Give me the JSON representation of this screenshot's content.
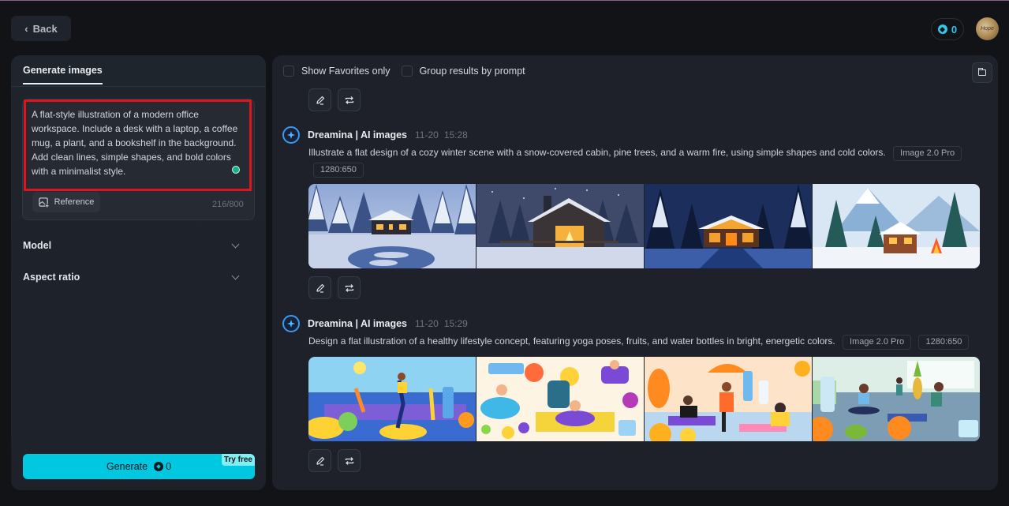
{
  "header": {
    "back_label": "Back",
    "credits": "0",
    "avatar_text": "Hope"
  },
  "left_panel": {
    "tab_label": "Generate images",
    "prompt_value": "A flat-style illustration of a modern office workspace. Include a desk with a laptop, a coffee mug, a plant, and a bookshelf in the background. Add clean lines, simple shapes, and bold colors with a minimalist style.",
    "reference_label": "Reference",
    "char_count": "216/800",
    "model_label": "Model",
    "aspect_ratio_label": "Aspect ratio",
    "generate_label": "Generate",
    "generate_cost": "0",
    "try_free_label": "Try free"
  },
  "right_panel": {
    "show_favorites_label": "Show Favorites only",
    "group_by_prompt_label": "Group results by prompt",
    "generations": [
      {
        "app_name": "Dreamina | AI images",
        "date": "11-20",
        "time": "15:28",
        "prompt": "Illustrate a flat design of a cozy winter scene with a snow-covered cabin, pine trees, and a warm fire, using simple shapes and cold colors.",
        "model_tag": "Image 2.0 Pro",
        "ratio_tag": "1280:650",
        "images": [
          "winter-cabin-twilight",
          "log-cabin-snowfall",
          "night-cabin-path",
          "mountain-cabin-campfire"
        ]
      },
      {
        "app_name": "Dreamina | AI images",
        "date": "11-20",
        "time": "15:29",
        "prompt": "Design a flat illustration of a healthy lifestyle concept, featuring yoga poses, fruits, and water bottles in bright, energetic colors.",
        "model_tag": "Image 2.0 Pro",
        "ratio_tag": "1280:650",
        "images": [
          "yoga-beach-fruits",
          "healthy-yoga-pattern",
          "yoga-group-pastel",
          "yoga-kitchen-oranges"
        ]
      }
    ]
  },
  "colors": {
    "accent_cyan": "#00c8e0",
    "credits_blue": "#31c8ea",
    "highlight_red": "#e0141c",
    "status_green": "#14b28c"
  }
}
